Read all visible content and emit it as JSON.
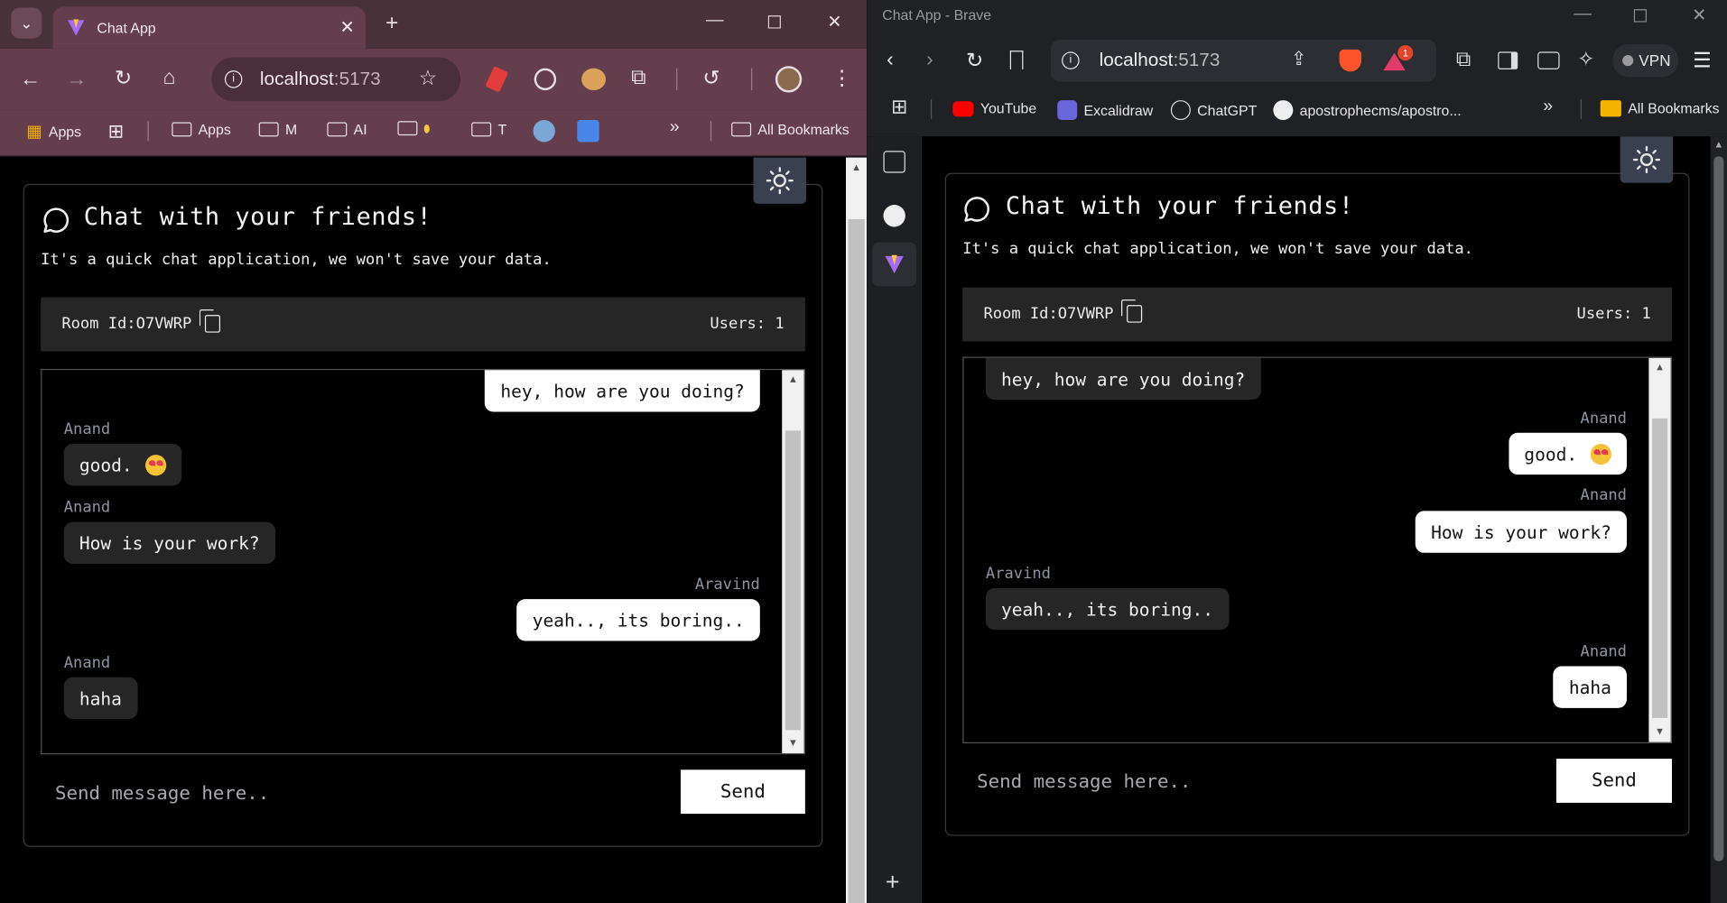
{
  "left_window": {
    "tab_title": "Chat App",
    "url_host": "localhost",
    "url_port": ":5173",
    "bookmarks": [
      "Apps",
      "Apps",
      "M",
      "AI",
      "",
      "T"
    ],
    "all_bookmarks": "All Bookmarks",
    "more": "»"
  },
  "right_window": {
    "window_title": "Chat App - Brave",
    "url_host": "localhost",
    "url_port": ":5173",
    "vpn_label": "VPN",
    "notif_count": "1",
    "bookmarks": [
      "YouTube",
      "Excalidraw",
      "ChatGPT",
      "apostrophecms/apostro..."
    ],
    "all_bookmarks": "All Bookmarks",
    "more": "»"
  },
  "app": {
    "title": "Chat with your friends!",
    "subtitle": "It's a quick chat application, we won't save your data.",
    "room_label": "Room Id:",
    "room_id": "O7VWRP",
    "users_label": "Users: 1",
    "input_placeholder": "Send message here..",
    "send_label": "Send"
  },
  "messages": [
    {
      "user": "",
      "text": "hey, how are you doing?",
      "emoji": false
    },
    {
      "user": "Anand",
      "text": "good.",
      "emoji": true
    },
    {
      "user": "Anand",
      "text": "How is your work?",
      "emoji": false
    },
    {
      "user": "Aravind",
      "text": "yeah.., its boring..",
      "emoji": false
    },
    {
      "user": "Anand",
      "text": "haha",
      "emoji": false
    }
  ],
  "colors": {
    "chrome_frame": "#643E4D",
    "brave_frame": "#202124",
    "app_bg": "#000000",
    "bubble_dark": "#262626",
    "bubble_light": "#ffffff"
  }
}
